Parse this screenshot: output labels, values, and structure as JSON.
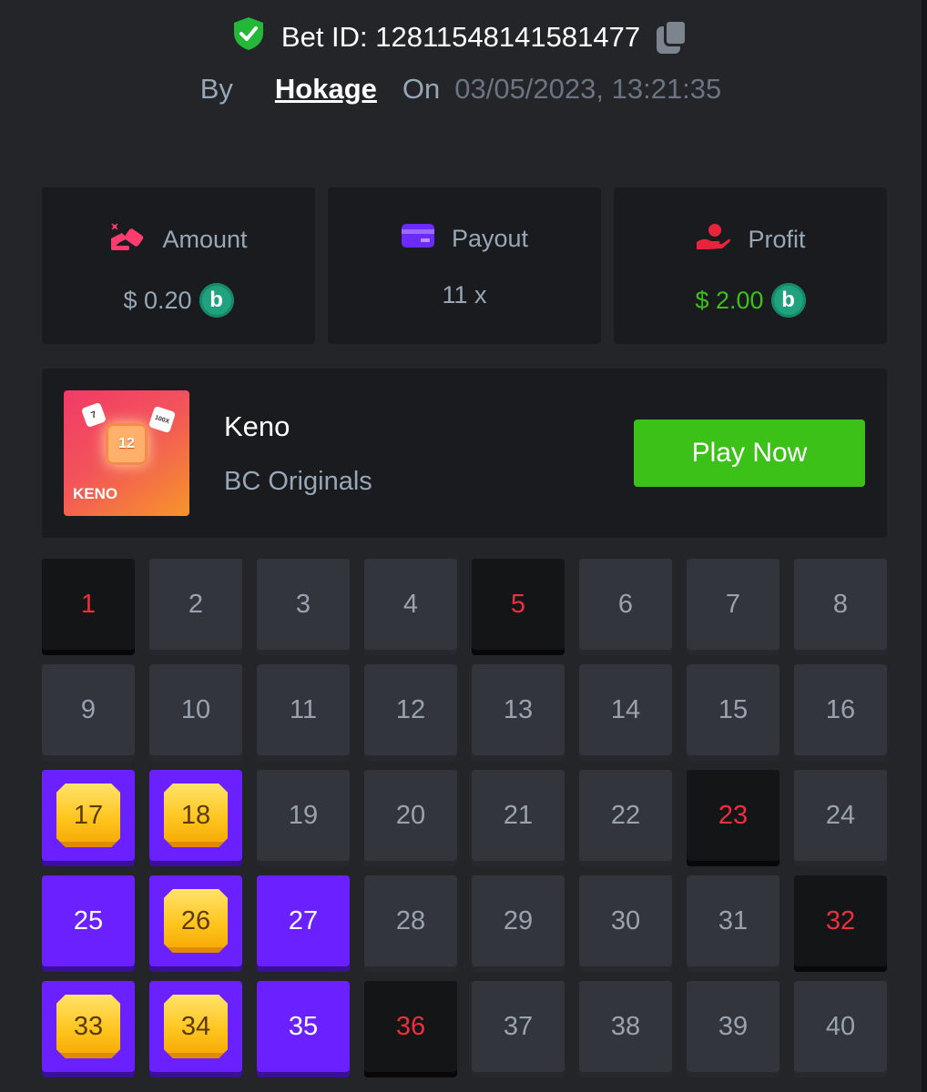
{
  "header": {
    "bet_id_label": "Bet ID: 12811548141581477",
    "by_label": "By",
    "username": "Hokage",
    "on_label": "On",
    "timestamp": "03/05/2023, 13:21:35"
  },
  "stats": {
    "amount": {
      "label": "Amount",
      "value": "$ 0.20",
      "icon": "bet-coins-icon"
    },
    "payout": {
      "label": "Payout",
      "value": "11 x",
      "icon": "wallet-card-icon"
    },
    "profit": {
      "label": "Profit",
      "value": "$ 2.00",
      "icon": "hand-profit-icon"
    },
    "coin_symbol": "b"
  },
  "game": {
    "thumb_label": "KENO",
    "thumb_number": "12",
    "thumb_dice1": "7",
    "thumb_dice2": "100X",
    "name": "Keno",
    "provider": "BC Originals",
    "play_label": "Play Now"
  },
  "colors": {
    "accent_green": "#3bc117",
    "pick_purple": "#6b20ff",
    "miss_red": "#ed2f3d",
    "gem_gold": "#ffc51f"
  },
  "grid": {
    "numbers": [
      1,
      2,
      3,
      4,
      5,
      6,
      7,
      8,
      9,
      10,
      11,
      12,
      13,
      14,
      15,
      16,
      17,
      18,
      19,
      20,
      21,
      22,
      23,
      24,
      25,
      26,
      27,
      28,
      29,
      30,
      31,
      32,
      33,
      34,
      35,
      36,
      37,
      38,
      39,
      40
    ],
    "hits": [
      17,
      18,
      26,
      33,
      34
    ],
    "picked_no_hit": [
      25,
      27,
      35
    ],
    "drawn_no_pick": [
      1,
      5,
      23,
      32,
      36
    ]
  }
}
